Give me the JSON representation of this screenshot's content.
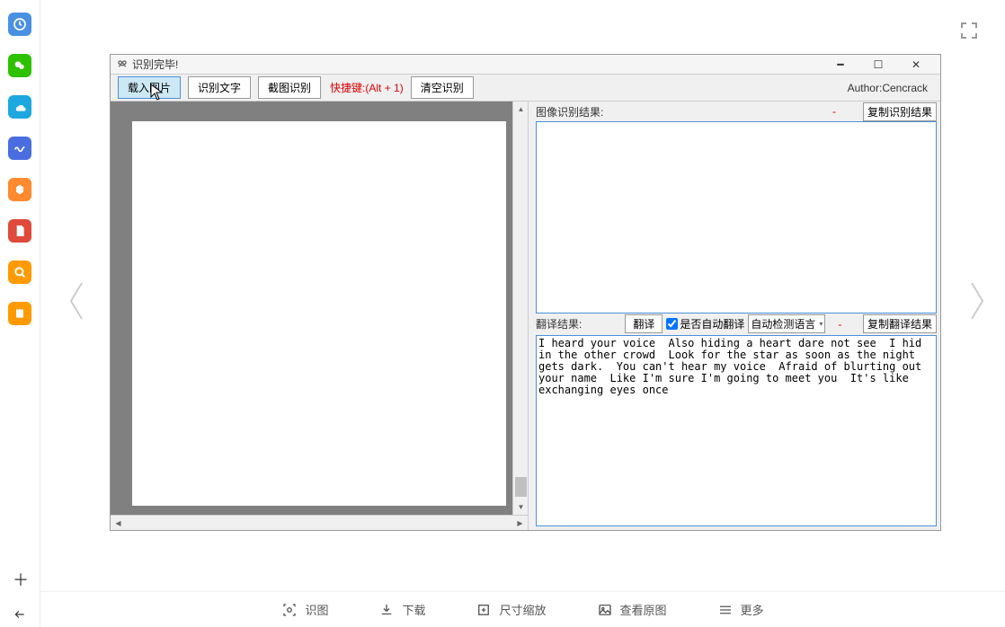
{
  "sidebar": {
    "icons": [
      {
        "name": "clock-icon",
        "bg": "#4a90e2"
      },
      {
        "name": "wechat-icon",
        "bg": "#2dc100"
      },
      {
        "name": "cloud-icon",
        "bg": "#1fa7e0"
      },
      {
        "name": "wave-icon",
        "bg": "#4a6ee0"
      },
      {
        "name": "shape-icon",
        "bg": "#ff8a30"
      },
      {
        "name": "pdf-icon",
        "bg": "#e04a3a"
      },
      {
        "name": "search-icon",
        "bg": "#ff9a00"
      },
      {
        "name": "book-icon",
        "bg": "#ff9a00"
      }
    ]
  },
  "window": {
    "title": "识别完毕!",
    "toolbar": {
      "load_image": "载入图片",
      "recognize_text": "识别文字",
      "screenshot_recognize": "截图识别",
      "hotkey": "快捷键:(Alt + 1)",
      "clear_recognize": "清空识别",
      "author": "Author:Cencrack"
    },
    "recognition": {
      "label": "图像识别结果:",
      "dash": "-",
      "copy_label": "复制识别结果",
      "content": ""
    },
    "translation": {
      "label": "翻译结果:",
      "translate_btn": "翻译",
      "auto_translate_label": "是否自动翻译",
      "auto_translate_checked": true,
      "lang_selected": "自动检测语言",
      "dash": "-",
      "copy_label": "复制翻译结果",
      "content": "I heard your voice  Also hiding a heart dare not see  I hid in the other crowd  Look for the star as soon as the night gets dark.  You can't hear my voice  Afraid of blurting out your name  Like I'm sure I'm going to meet you  It's like exchanging eyes once"
    }
  },
  "bottom_bar": {
    "recognize": "识图",
    "download": "下载",
    "zoom": "尺寸缩放",
    "view_original": "查看原图",
    "more": "更多"
  }
}
